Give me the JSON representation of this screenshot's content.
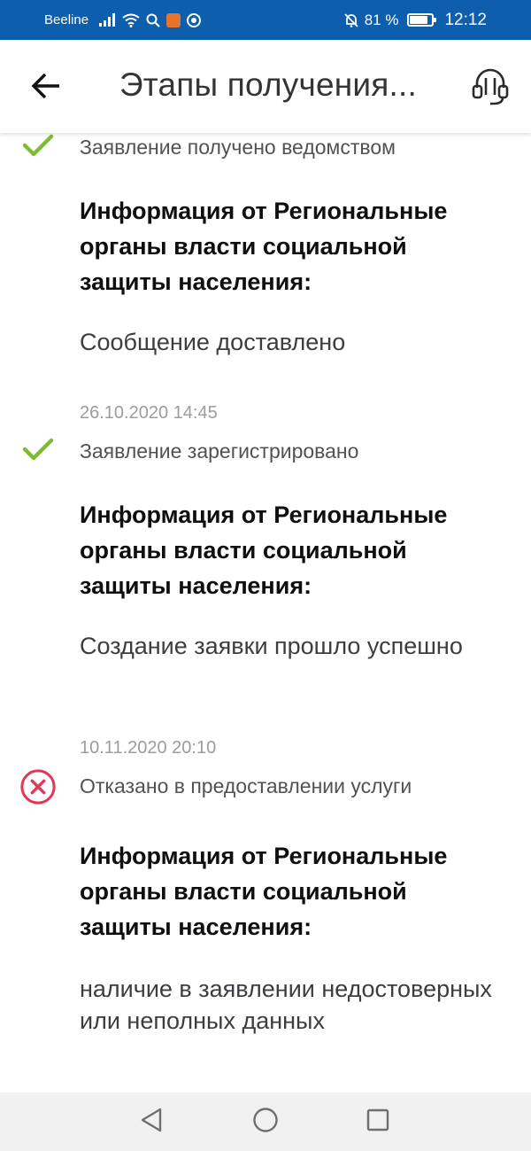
{
  "status_bar": {
    "carrier": "Beeline",
    "battery_percent_text": "81 %",
    "battery_level": 0.81,
    "time": "12:12",
    "icons": [
      "signal-icon",
      "wifi-icon",
      "search-icon",
      "app-notification-icon",
      "chrome-icon",
      "do-not-disturb-icon",
      "battery-icon"
    ]
  },
  "app_bar": {
    "title": "Этапы получения...",
    "back_icon": "arrow-left-icon",
    "support_icon": "headset-support-icon"
  },
  "stages": [
    {
      "date": "",
      "status": "Заявление получено ведомством",
      "status_icon": "check-icon",
      "info_heading": "Информация от Региональные органы власти социальной защиты населения:",
      "info_message": "Сообщение доставлено"
    },
    {
      "date": "26.10.2020 14:45",
      "status": "Заявление зарегистрировано",
      "status_icon": "check-icon",
      "info_heading": "Информация от Региональные органы власти социальной защиты населения:",
      "info_message": "Создание заявки прошло успешно"
    },
    {
      "date": "10.11.2020 20:10",
      "status": "Отказано в предоставлении услуги",
      "status_icon": "rejected-icon",
      "info_heading": "Информация от Региональные органы власти социальной защиты населения:",
      "info_message": "наличие в заявлении недостоверных или неполных данных"
    }
  ],
  "colors": {
    "status_bar_bg": "#0d5fad",
    "check_green": "#7dbb2f",
    "reject_red": "#e0385a",
    "heading_text": "#0e0f11",
    "date_gray": "#9a9ca2"
  },
  "nav_bar": {
    "icons": [
      "back-triangle-icon",
      "home-circle-icon",
      "recents-square-icon"
    ]
  }
}
